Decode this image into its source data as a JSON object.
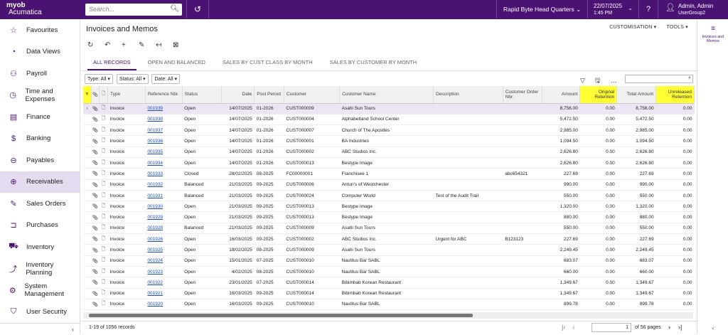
{
  "topbar": {
    "logo_line1": "myob",
    "logo_line2": "Acumatica",
    "search_placeholder": "Search...",
    "branch": "Rapid Byte Head Quarters",
    "date": "22/07/2025",
    "time": "1:45 PM",
    "user_name": "Admin, Admin",
    "user_group": "UserGroup2"
  },
  "sidebar": {
    "items": [
      {
        "label": "Favourites",
        "icon": "☆"
      },
      {
        "label": "Data Views",
        "icon": "◔"
      },
      {
        "label": "Payroll",
        "icon": "⚇"
      },
      {
        "label": "Time and Expenses",
        "icon": "◷"
      },
      {
        "label": "Finance",
        "icon": "▤"
      },
      {
        "label": "Banking",
        "icon": "$"
      },
      {
        "label": "Payables",
        "icon": "⊖"
      },
      {
        "label": "Receivables",
        "icon": "⊕"
      },
      {
        "label": "Sales Orders",
        "icon": "✎"
      },
      {
        "label": "Purchases",
        "icon": "⊐"
      },
      {
        "label": "Inventory",
        "icon": "⛟"
      },
      {
        "label": "Inventory Planning",
        "icon": "⤴"
      },
      {
        "label": "System Management",
        "icon": "⚙"
      },
      {
        "label": "User Security",
        "icon": "⛉"
      }
    ]
  },
  "page": {
    "title": "Invoices and Memos",
    "customisation": "CUSTOMISATION",
    "tools": "TOOLS"
  },
  "tabs": [
    "ALL RECORDS",
    "OPEN AND BALANCED",
    "SALES BY CUST CLASS BY MONTH",
    "SALES BY CUSTOMER BY MONTH"
  ],
  "filters": {
    "type": "Type: All",
    "status": "Status: All",
    "date": "Date: All"
  },
  "grid": {
    "headers": [
      "Type",
      "Reference Nbr.",
      "Status",
      "Date",
      "Post Period",
      "Customer",
      "Customer Name",
      "Description",
      "Customer Order Nbr.",
      "Amount",
      "Original Retention",
      "Total Amount",
      "Unreleased Retention"
    ],
    "rows": [
      [
        "Invoice",
        "001939",
        "Open",
        "14/07/2025",
        "01-2026",
        "CUST000009",
        "Asahi Sun Tours",
        "",
        "",
        "8,756.00",
        "0.00",
        "8,756.00",
        "0.00"
      ],
      [
        "Invoice",
        "001938",
        "Open",
        "14/07/2025",
        "01-2026",
        "CUST000004",
        "Alphabetland School Center",
        "",
        "",
        "5,472.50",
        "0.00",
        "5,472.50",
        "0.00"
      ],
      [
        "Invoice",
        "001937",
        "Open",
        "14/07/2025",
        "01-2026",
        "CUST000007",
        "Church of The Apostles",
        "",
        "",
        "2,985.00",
        "0.00",
        "2,985.00",
        "0.00"
      ],
      [
        "Invoice",
        "001936",
        "Open",
        "14/07/2025",
        "01-2026",
        "CUST000001",
        "BA Industries",
        "",
        "",
        "1,094.50",
        "0.00",
        "1,094.50",
        "0.00"
      ],
      [
        "Invoice",
        "001935",
        "Open",
        "14/07/2025",
        "01-2026",
        "CUST000002",
        "ABC Studios Inc.",
        "",
        "",
        "2,626.80",
        "0.00",
        "2,626.80",
        "0.00"
      ],
      [
        "Invoice",
        "001934",
        "Open",
        "14/07/2025",
        "01-2026",
        "CUST000013",
        "Bestype Image",
        "",
        "",
        "2,626.80",
        "0.00",
        "2,626.80",
        "0.00"
      ],
      [
        "Invoice",
        "001933",
        "Closed",
        "28/02/2025",
        "08-2025",
        "FC00000001",
        "Franchisee 1",
        "",
        "abc654321",
        "227.69",
        "0.00",
        "227.69",
        "0.00"
      ],
      [
        "Invoice",
        "001932",
        "Balanced",
        "21/03/2025",
        "09-2025",
        "CUST000006",
        "Antun's of Westchester",
        "",
        "",
        "990.00",
        "0.00",
        "990.00",
        "0.00"
      ],
      [
        "Invoice",
        "001931",
        "Balanced",
        "21/03/2025",
        "09-2025",
        "CUST000024",
        "Computer World",
        "Test of the Audit Trail",
        "",
        "550.00",
        "0.00",
        "550.00",
        "0.00"
      ],
      [
        "Invoice",
        "001930",
        "Open",
        "21/03/2025",
        "09-2025",
        "CUST000013",
        "Bestype Image",
        "",
        "",
        "1,320.00",
        "0.00",
        "1,320.00",
        "0.00"
      ],
      [
        "Invoice",
        "001929",
        "Open",
        "21/03/2025",
        "09-2025",
        "CUST000013",
        "Bestype Image",
        "",
        "",
        "880.00",
        "0.00",
        "880.00",
        "0.00"
      ],
      [
        "Invoice",
        "001928",
        "Balanced",
        "21/03/2025",
        "09-2025",
        "CUST000009",
        "Asahi Sun Tours",
        "",
        "",
        "550.00",
        "0.00",
        "550.00",
        "0.00"
      ],
      [
        "Invoice",
        "001926",
        "Open",
        "16/03/2025",
        "09-2025",
        "CUST000002",
        "ABC Studios Inc.",
        "Urgent for ABC",
        "B123123",
        "227.69",
        "0.00",
        "227.69",
        "0.00"
      ],
      [
        "Invoice",
        "001925",
        "Open",
        "18/02/2025",
        "08-2025",
        "CUST000009",
        "Asahi Sun Tours",
        "",
        "",
        "2,249.45",
        "0.00",
        "2,249.45",
        "0.00"
      ],
      [
        "Invoice",
        "001924",
        "Open",
        "15/01/2025",
        "07-2025",
        "CUST000010",
        "Nautilus Bar SABL",
        "",
        "",
        "683.07",
        "0.00",
        "683.07",
        "0.00"
      ],
      [
        "Invoice",
        "001923",
        "Open",
        "4/02/2025",
        "08-2025",
        "CUST000010",
        "Nautilus Bar SABL",
        "",
        "",
        "660.00",
        "0.00",
        "660.00",
        "0.00"
      ],
      [
        "Invoice",
        "001922",
        "Open",
        "23/01/2025",
        "07-2025",
        "CUST000014",
        "Bibimbab Korean Restaurant",
        "",
        "",
        "1,349.67",
        "0.00",
        "1,349.67",
        "0.00"
      ],
      [
        "Invoice",
        "001921",
        "Open",
        "16/03/2025",
        "09-2025",
        "CUST000014",
        "Bibimbab Korean Restaurant",
        "",
        "",
        "1,349.67",
        "0.00",
        "1,349.67",
        "0.00"
      ],
      [
        "Invoice",
        "001920",
        "Open",
        "16/03/2025",
        "09-2025",
        "CUST000010",
        "Nautilus Bar SABL",
        "",
        "",
        "899.78",
        "0.00",
        "899.78",
        "0.00"
      ]
    ]
  },
  "pager": {
    "count": "1-19 of 1056 records",
    "page": "1",
    "of_pages": "of 56 pages"
  },
  "rightpanel": {
    "label": "Invoices and Memos"
  },
  "colors": {
    "brand": "#4a1273",
    "highlight": "#ffff33",
    "link": "#1a4fc4"
  }
}
